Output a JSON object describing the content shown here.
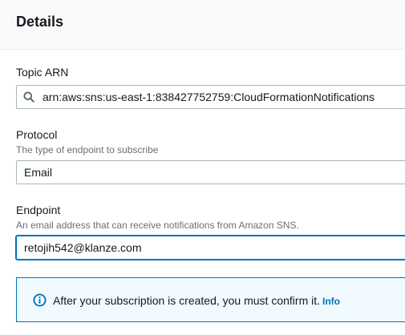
{
  "header": {
    "title": "Details"
  },
  "topic_arn": {
    "label": "Topic ARN",
    "value": "arn:aws:sns:us-east-1:838427752759:CloudFormationNotifications"
  },
  "protocol": {
    "label": "Protocol",
    "description": "The type of endpoint to subscribe",
    "value": "Email"
  },
  "endpoint": {
    "label": "Endpoint",
    "description": "An email address that can receive notifications from Amazon SNS.",
    "value": "retojih542@klanze.com"
  },
  "alert": {
    "text": "After your subscription is created, you must confirm it.",
    "link": "Info",
    "icon": "info-icon",
    "color": "#0073bb"
  }
}
